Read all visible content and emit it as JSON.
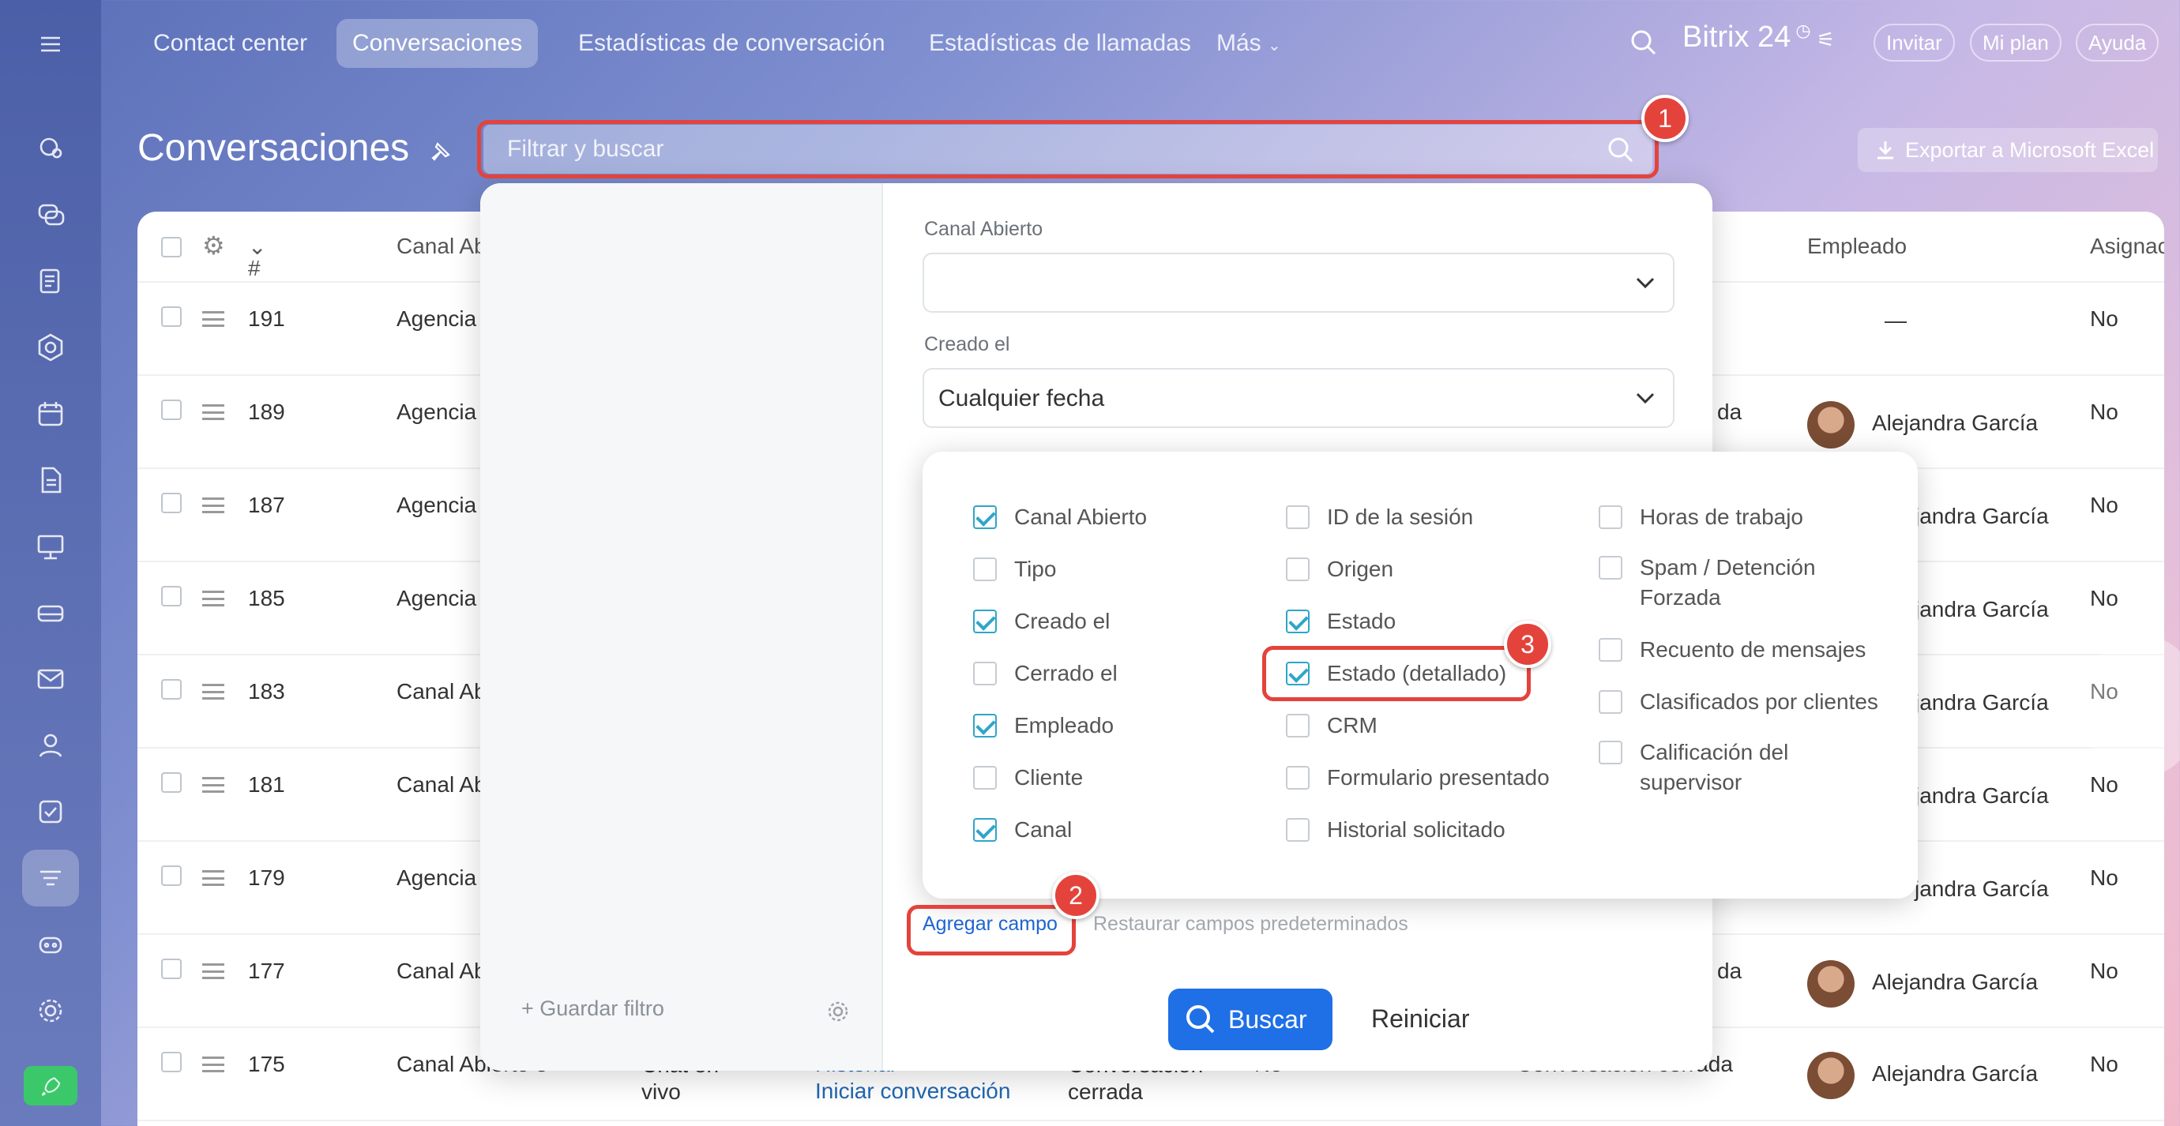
{
  "nav": {
    "tabs": [
      "Contact center",
      "Conversaciones",
      "Estadísticas de conversación",
      "Estadísticas de llamadas",
      "Más"
    ],
    "brand": "Bitrix 24",
    "invite": "Invitar",
    "plan": "Mi plan",
    "help": "Ayuda"
  },
  "page": {
    "title": "Conversaciones",
    "search_placeholder": "Filtrar y buscar",
    "export": "Exportar a Microsoft Excel"
  },
  "table": {
    "headers": {
      "num": "#",
      "channel": "Canal Ab",
      "employee": "Empleado",
      "assigned": "Asignac"
    },
    "rows": [
      {
        "id": "191",
        "channel": "Agencia",
        "employee": "—",
        "assigned": "No"
      },
      {
        "id": "189",
        "channel": "Agencia",
        "status_tail": "da",
        "employee": "Alejandra García",
        "assigned": "No"
      },
      {
        "id": "187",
        "channel": "Agencia",
        "employee": "jandra García",
        "assigned": "No"
      },
      {
        "id": "185",
        "channel": "Agencia",
        "employee": "jandra García",
        "assigned": "No"
      },
      {
        "id": "183",
        "channel": "Canal Ab",
        "employee": "jandra García",
        "assigned": "No"
      },
      {
        "id": "181",
        "channel": "Canal Ab",
        "employee": "jandra García",
        "assigned": "No"
      },
      {
        "id": "179",
        "channel": "Agencia",
        "employee": "jandra García",
        "assigned": "No"
      },
      {
        "id": "177",
        "channel": "Canal Ab",
        "status_tail": "da",
        "employee": "Alejandra García",
        "assigned": "No"
      },
      {
        "id": "175",
        "channel": "Canal Abierto 3",
        "type": "Chat en vivo",
        "link1": "Historial",
        "link2": "Iniciar conversación",
        "state": "Conversación cerrada",
        "crm": "No",
        "state2": "Conversación cerrada",
        "employee": "Alejandra García",
        "assigned": "No"
      }
    ]
  },
  "filter": {
    "canal_label": "Canal Abierto",
    "canal_value": "",
    "created_label": "Creado el",
    "created_value": "Cualquier fecha",
    "add_field": "Agregar campo",
    "restore": "Restaurar campos predeterminados",
    "search_btn": "Buscar",
    "reset_btn": "Reiniciar",
    "save_filter": "Guardar filtro"
  },
  "chooser": {
    "col1": [
      {
        "label": "Canal Abierto",
        "checked": true
      },
      {
        "label": "Tipo",
        "checked": false
      },
      {
        "label": "Creado el",
        "checked": true
      },
      {
        "label": "Cerrado el",
        "checked": false
      },
      {
        "label": "Empleado",
        "checked": true
      },
      {
        "label": "Cliente",
        "checked": false
      },
      {
        "label": "Canal",
        "checked": true
      }
    ],
    "col2": [
      {
        "label": "ID de la sesión",
        "checked": false
      },
      {
        "label": "Origen",
        "checked": false
      },
      {
        "label": "Estado",
        "checked": true
      },
      {
        "label": "Estado (detallado)",
        "checked": true
      },
      {
        "label": "CRM",
        "checked": false
      },
      {
        "label": "Formulario presentado",
        "checked": false
      },
      {
        "label": "Historial solicitado",
        "checked": false
      }
    ],
    "col3": [
      {
        "label": "Horas de trabajo",
        "checked": false
      },
      {
        "label": "Spam / Detención Forzada",
        "checked": false
      },
      {
        "label": "Recuento de mensajes",
        "checked": false
      },
      {
        "label": "Clasificados por clientes",
        "checked": false
      },
      {
        "label": "Calificación del supervisor",
        "checked": false
      }
    ]
  },
  "callouts": [
    "1",
    "2",
    "3"
  ],
  "colors": {
    "accent": "#1f6fe6",
    "highlight": "#e4433b",
    "check": "#2fa5c9"
  }
}
